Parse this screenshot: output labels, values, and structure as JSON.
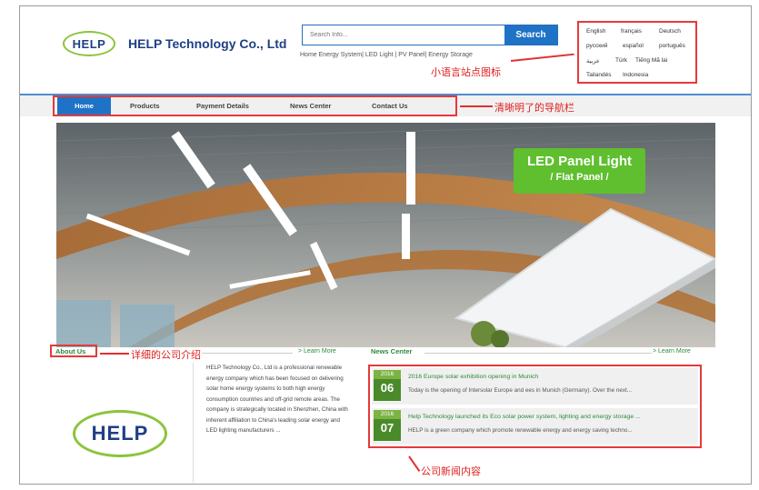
{
  "header": {
    "logo_text": "HELP",
    "company_name": "HELP Technology Co., Ltd",
    "search": {
      "placeholder": "Search Info...",
      "button_label": "Search"
    },
    "quick_links": "Home Energy System| LED Light | PV Panel| Energy Storage"
  },
  "languages": {
    "row1": [
      "English",
      "français",
      "Deutsch"
    ],
    "row2": [
      "русский",
      "español",
      "português"
    ],
    "row3": [
      "عربية",
      "Türk",
      "Tiếng Mã lai"
    ],
    "row4": [
      "Tailandés",
      "Indonesia"
    ]
  },
  "annotations": {
    "lang": "小语言站点图标",
    "nav": "清晰明了的导航栏",
    "about": "详细的公司介绍",
    "news": "公司新闻内容"
  },
  "nav": {
    "items": [
      "Home",
      "Products",
      "Payment Details",
      "News Center",
      "Contact Us"
    ]
  },
  "hero": {
    "line1": "LED Panel Light",
    "line2": "/ Flat Panel /"
  },
  "about": {
    "title": "About Us",
    "learn_more": "> Learn More",
    "logo_text": "HELP",
    "text": "HELP Technology Co., Ltd is a professional renewable energy company which has been focused on delivering solar home energy systems to both high energy consumption countries and off-grid remote areas. The company is strategically located in Shenzhen, China with inherent affiliation to China's leading solar energy and LED lighting manufacturers ..."
  },
  "news": {
    "title": "News Center",
    "learn_more": "> Learn More",
    "items": [
      {
        "year": "2016",
        "day": "06",
        "title": "2016 Europe solar exhibition opening in Munich",
        "desc": "Today is the opening of Intersolar Europe and ees in Munich (Germany). Over the next..."
      },
      {
        "year": "2016",
        "day": "07",
        "title": "Help Technology launched its Eco solar power system, lighting and energy storage ...",
        "desc": "HELP is a green company which promote renewable energy and energy saving techno..."
      }
    ]
  },
  "colors": {
    "brand_blue": "#1e73c7",
    "brand_green": "#5fbf2f",
    "annotation_red": "#e43a3a"
  }
}
